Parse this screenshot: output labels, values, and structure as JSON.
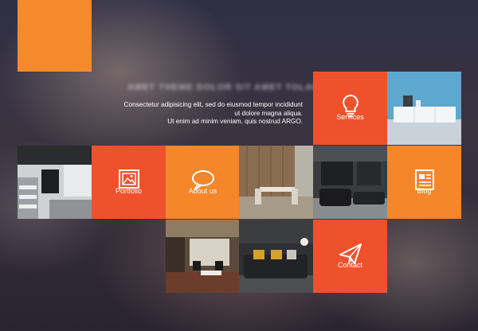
{
  "hero": {
    "headline": "AMET THEME DOLOR SIT AMET TOLARE",
    "line1": "Consectetur adipisicing elit, sed do eiusmod tempor incididunt",
    "line2": "ut dolore magna aliqua.",
    "line3": "Ut enim ad minim veniam, quis nostrud ARGO."
  },
  "tiles": {
    "services": {
      "label": "Services",
      "icon": "lightbulb-icon"
    },
    "portfolio": {
      "label": "Portfolio",
      "icon": "picture-frame-icon"
    },
    "about": {
      "label": "About us",
      "icon": "speech-bubble-icon"
    },
    "blog": {
      "label": "Blog",
      "icon": "newspaper-icon"
    },
    "contact": {
      "label": "Contact",
      "icon": "paper-plane-icon"
    }
  },
  "colors": {
    "red": "#f0512d",
    "orange": "#f6862a",
    "logo": "#f58a2d"
  }
}
